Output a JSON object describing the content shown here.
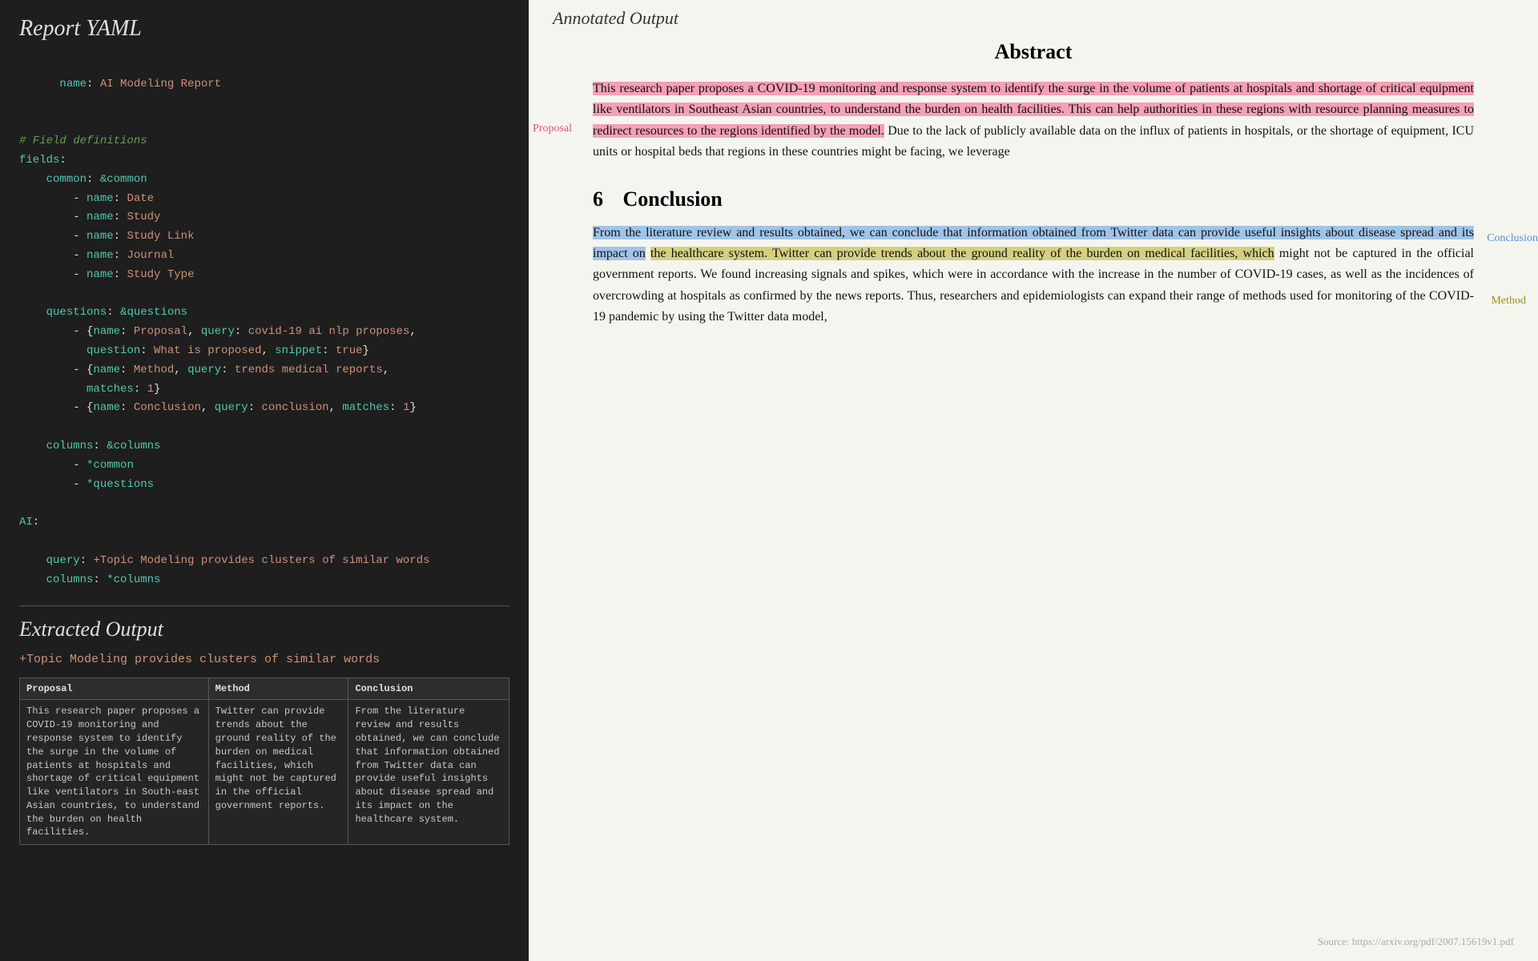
{
  "left": {
    "title": "Report YAML",
    "yaml_lines": [
      {
        "type": "key-value",
        "key": "name",
        "value": "AI Modeling Report"
      },
      {
        "type": "blank"
      },
      {
        "type": "comment",
        "text": "# Field definitions"
      },
      {
        "type": "key",
        "text": "fields:"
      },
      {
        "type": "indent-key",
        "text": "common: &common"
      },
      {
        "type": "list-item",
        "text": "- name: Date"
      },
      {
        "type": "list-item",
        "text": "- name: Study"
      },
      {
        "type": "list-item",
        "text": "- name: Study Link"
      },
      {
        "type": "list-item",
        "text": "- name: Journal"
      },
      {
        "type": "list-item",
        "text": "- name: Study Type"
      },
      {
        "type": "blank"
      },
      {
        "type": "indent-key",
        "text": "questions: &questions"
      },
      {
        "type": "list-item-complex",
        "text": "- {name: Proposal, query: covid-19 ai nlp proposes,"
      },
      {
        "type": "list-item-cont",
        "text": "  question: What is proposed, snippet: true}"
      },
      {
        "type": "list-item-complex",
        "text": "- {name: Method, query: trends medical reports,"
      },
      {
        "type": "list-item-cont",
        "text": "  matches: 1}"
      },
      {
        "type": "list-item-complex",
        "text": "- {name: Conclusion, query: conclusion, matches: 1}"
      },
      {
        "type": "blank"
      },
      {
        "type": "indent-key",
        "text": "columns: &columns"
      },
      {
        "type": "list-item",
        "text": "- *common"
      },
      {
        "type": "list-item",
        "text": "- *questions"
      },
      {
        "type": "blank"
      },
      {
        "type": "key",
        "text": "AI:"
      },
      {
        "type": "blank"
      },
      {
        "type": "ai-query",
        "text": "query: +Topic Modeling provides clusters of similar words"
      },
      {
        "type": "ai-columns",
        "text": "columns: *columns"
      }
    ],
    "extracted_title": "Extracted Output",
    "extracted_query": "+Topic Modeling provides clusters of similar words",
    "table_headers": [
      "Proposal",
      "Method",
      "Conclusion"
    ],
    "table_row": [
      "This research paper proposes a COVID-19 monitoring and response system to identify the surge in the volume of patients at hospitals and shortage of critical equipment like ventilators in South-east Asian countries, to understand the burden on health facilities.",
      "Twitter can provide trends about the ground reality of the burden on medical facilities, which might not be captured in the official government reports.",
      "From the literature review and results obtained, we can conclude that information obtained from Twitter data can provide useful insights about disease spread and its impact on the healthcare system."
    ]
  },
  "right": {
    "header": "Annotated Output",
    "abstract_title": "Abstract",
    "abstract_text_proposal": "This research paper proposes a COVID-19 monitoring and response system to identify the surge in the volume of patients at hospitals and shortage of critical equipment like ventilators in Southeast Asian countries, to understand the burden on health facilities. This can help authorities in these regions with resource planning measures to redirect resources to the regions identified by the model. Due to the lack of publicly available data on the influx of patients in hospitals, or the shortage of equipment, ICU units or hospital beds that regions in these countries might be facing, we leverage",
    "proposal_label": "Proposal",
    "section_number": "6",
    "section_title": "Conclusion",
    "conclusion_text_blue": "From the literature review and results obtained, we can conclude that information obtained from Twitter data can provide useful insights about disease spread and its impact on",
    "conclusion_text_yellow": "the healthcare system. Twitter can provide trends about the ground reality of the burden on medical facilities, which",
    "conclusion_text_plain": "might not be captured in the official government reports. We found increasing signals and spikes, which were in accordance with the increase in the number of COVID-19 cases, as well as the incidences of overcrowding at hospitals as confirmed by the news reports. Thus, researchers and epidemiologists can expand their range of methods used for monitoring of the COVID-19 pandemic by using the Twitter data model,",
    "conclusion_label": "Conclusion",
    "method_label": "Method",
    "source": "Source: https://arxiv.org/pdf/2007.15619v1.pdf"
  }
}
